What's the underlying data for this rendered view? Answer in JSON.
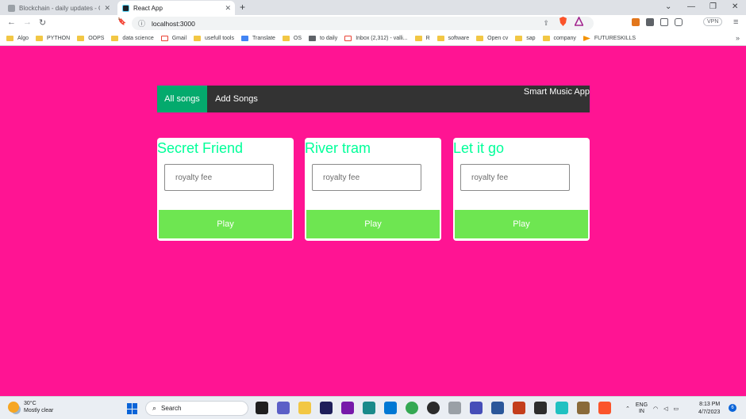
{
  "browser": {
    "tabs": [
      {
        "title": "Blockchain - daily updates - Google D",
        "close": "✕"
      },
      {
        "title": "React App",
        "close": "✕"
      }
    ],
    "new_tab": "+",
    "window_controls": {
      "dropdown": "⌄",
      "minimize": "—",
      "maximize": "❐",
      "close": "✕"
    },
    "nav": {
      "back": "←",
      "forward": "→",
      "reload": "↻",
      "bookmark": "🔖"
    },
    "address": {
      "url": "localhost:3000",
      "info_icon": "ⓘ",
      "share_icon": "⇪"
    },
    "vpn_label": "VPN",
    "menu": "≡",
    "bookmarks": [
      {
        "label": "Algo",
        "icon": "folder"
      },
      {
        "label": "PYTHON",
        "icon": "folder"
      },
      {
        "label": "OOPS",
        "icon": "folder"
      },
      {
        "label": "data science",
        "icon": "folder"
      },
      {
        "label": "Gmail",
        "icon": "gmail"
      },
      {
        "label": "usefull tools",
        "icon": "folder"
      },
      {
        "label": "Translate",
        "icon": "translate"
      },
      {
        "label": "OS",
        "icon": "folder"
      },
      {
        "label": "to daily",
        "icon": "site"
      },
      {
        "label": "Inbox (2,312) - valli...",
        "icon": "gmail"
      },
      {
        "label": "R",
        "icon": "folder"
      },
      {
        "label": "software",
        "icon": "folder"
      },
      {
        "label": "Open cv",
        "icon": "folder"
      },
      {
        "label": "sap",
        "icon": "folder"
      },
      {
        "label": "company",
        "icon": "folder"
      },
      {
        "label": "FUTURESKILLS",
        "icon": "arrow"
      }
    ],
    "bookmarks_more": "»"
  },
  "app": {
    "nav": {
      "all_songs": "All songs",
      "add_songs": "Add Songs",
      "brand": "Smart Music App"
    },
    "songs": [
      {
        "title": "Secret Friend",
        "placeholder": "royalty fee",
        "button": "Play"
      },
      {
        "title": "River tram",
        "placeholder": "royalty fee",
        "button": "Play"
      },
      {
        "title": "Let it go",
        "placeholder": "royalty fee",
        "button": "Play"
      }
    ],
    "colors": {
      "background": "#ff1493",
      "navbar": "#333333",
      "active_tab": "#04aa6d",
      "title": "#00ff99",
      "play": "#6ee651"
    }
  },
  "taskbar": {
    "weather": {
      "temp": "30°C",
      "desc": "Mostly clear"
    },
    "search_label": "Search",
    "language": {
      "line1": "ENG",
      "line2": "IN"
    },
    "tray_icons": [
      "chevron-up-icon",
      "wifi-icon",
      "speaker-icon",
      "battery-icon"
    ],
    "clock": {
      "time": "8:13 PM",
      "date": "4/7/2023"
    },
    "notification_count": "6"
  }
}
